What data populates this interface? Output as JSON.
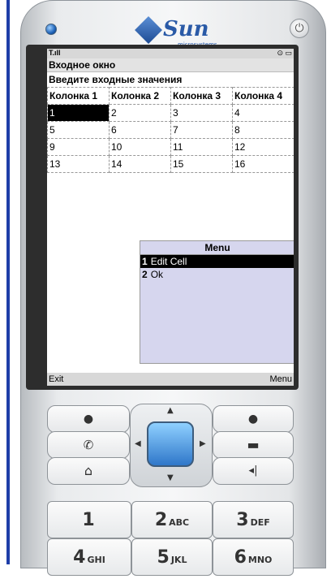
{
  "phone": {
    "brand": "Sun",
    "sub_brand": "microsystems",
    "power_icon": "power-icon"
  },
  "status": {
    "signal": "T.ıll",
    "right": "⊙ ▭"
  },
  "screen": {
    "title": "Входное окно",
    "subtitle": "Введите входные значения",
    "table": {
      "headers": [
        "Колонка 1",
        "Колонка 2",
        "Колонка 3",
        "Колонка 4"
      ],
      "rows": [
        [
          "1",
          "2",
          "3",
          "4"
        ],
        [
          "5",
          "6",
          "7",
          "8"
        ],
        [
          "9",
          "10",
          "11",
          "12"
        ],
        [
          "13",
          "14",
          "15",
          "16"
        ]
      ],
      "selected_cell": "1"
    },
    "menu": {
      "title": "Menu",
      "items": [
        {
          "num": "1",
          "label": "Edit Cell"
        },
        {
          "num": "2",
          "label": "Ok"
        }
      ]
    },
    "softkeys": {
      "left": "Exit",
      "right": "Menu"
    }
  },
  "keypad": [
    {
      "digit": "1",
      "letters": ""
    },
    {
      "digit": "2",
      "letters": "ABC"
    },
    {
      "digit": "3",
      "letters": "DEF"
    },
    {
      "digit": "4",
      "letters": "GHI"
    },
    {
      "digit": "5",
      "letters": "JKL"
    },
    {
      "digit": "6",
      "letters": "MNO"
    }
  ],
  "icons": [
    "dot-icon",
    "call-icon",
    "home-icon",
    "end-call-icon",
    "back-icon"
  ]
}
